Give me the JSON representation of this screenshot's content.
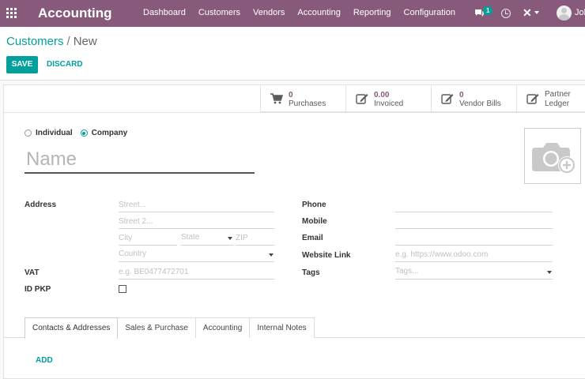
{
  "app": {
    "name": "Accounting"
  },
  "navbar": {
    "menu": [
      "Dashboard",
      "Customers",
      "Vendors",
      "Accounting",
      "Reporting",
      "Configuration"
    ],
    "chat_badge": "1",
    "user_name": "Joh",
    "icons": [
      "apps-grid-icon",
      "chat-icon",
      "clock-icon",
      "debug-icon",
      "avatar"
    ]
  },
  "breadcrumb": {
    "parent": "Customers",
    "separator": "/",
    "current": "New"
  },
  "actions": {
    "save": "SAVE",
    "discard": "DISCARD"
  },
  "stat_buttons": [
    {
      "value": "0",
      "label": "Purchases",
      "icon": "cart-icon"
    },
    {
      "value": "0.00",
      "label": "Invoiced",
      "icon": "edit-icon"
    },
    {
      "value": "0",
      "label": "Vendor Bills",
      "icon": "edit-icon"
    },
    {
      "label_line1": "Partner",
      "label_line2": "Ledger",
      "icon": "edit-icon"
    }
  ],
  "company_type": {
    "options": [
      "Individual",
      "Company"
    ],
    "selected": "Company"
  },
  "name_placeholder": "Name",
  "address": {
    "label": "Address",
    "street_placeholder": "Street...",
    "street2_placeholder": "Street 2...",
    "city_placeholder": "City",
    "state_placeholder": "State",
    "zip_placeholder": "ZIP",
    "country_placeholder": "Country"
  },
  "vat": {
    "label": "VAT",
    "placeholder": "e.g. BE0477472701"
  },
  "id_pkp": {
    "label": "ID PKP",
    "checked": false
  },
  "contact": {
    "phone_label": "Phone",
    "mobile_label": "Mobile",
    "email_label": "Email",
    "website_label": "Website Link",
    "website_placeholder": "e.g. https://www.odoo.com",
    "tags_label": "Tags",
    "tags_placeholder": "Tags..."
  },
  "tabs": [
    "Contacts & Addresses",
    "Sales & Purchase",
    "Accounting",
    "Internal Notes"
  ],
  "active_tab": "Contacts & Addresses",
  "add_label": "ADD",
  "colors": {
    "navbar": "#875a7b",
    "accent": "#00a09d"
  }
}
